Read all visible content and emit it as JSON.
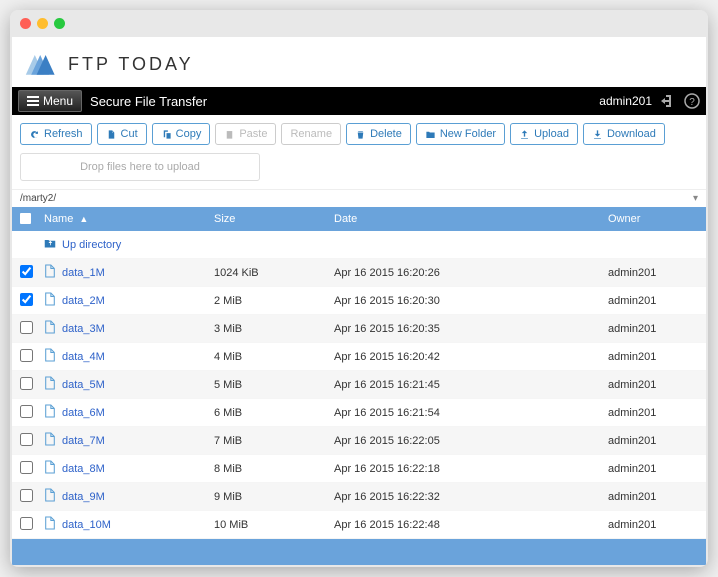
{
  "brand": "FTP TODAY",
  "menubar": {
    "menu_label": "Menu",
    "app_title": "Secure File Transfer",
    "username": "admin201"
  },
  "toolbar": {
    "refresh": "Refresh",
    "cut": "Cut",
    "copy": "Copy",
    "paste": "Paste",
    "rename": "Rename",
    "delete": "Delete",
    "new_folder": "New Folder",
    "upload": "Upload",
    "download": "Download"
  },
  "dropzone": "Drop files here to upload",
  "path": "/marty2/",
  "columns": {
    "name": "Name",
    "size": "Size",
    "date": "Date",
    "owner": "Owner"
  },
  "up_directory": "Up directory",
  "files": [
    {
      "checked": true,
      "name": "data_1M",
      "size": "1024 KiB",
      "date": "Apr 16 2015 16:20:26",
      "owner": "admin201"
    },
    {
      "checked": true,
      "name": "data_2M",
      "size": "2 MiB",
      "date": "Apr 16 2015 16:20:30",
      "owner": "admin201"
    },
    {
      "checked": false,
      "name": "data_3M",
      "size": "3 MiB",
      "date": "Apr 16 2015 16:20:35",
      "owner": "admin201"
    },
    {
      "checked": false,
      "name": "data_4M",
      "size": "4 MiB",
      "date": "Apr 16 2015 16:20:42",
      "owner": "admin201"
    },
    {
      "checked": false,
      "name": "data_5M",
      "size": "5 MiB",
      "date": "Apr 16 2015 16:21:45",
      "owner": "admin201"
    },
    {
      "checked": false,
      "name": "data_6M",
      "size": "6 MiB",
      "date": "Apr 16 2015 16:21:54",
      "owner": "admin201"
    },
    {
      "checked": false,
      "name": "data_7M",
      "size": "7 MiB",
      "date": "Apr 16 2015 16:22:05",
      "owner": "admin201"
    },
    {
      "checked": false,
      "name": "data_8M",
      "size": "8 MiB",
      "date": "Apr 16 2015 16:22:18",
      "owner": "admin201"
    },
    {
      "checked": false,
      "name": "data_9M",
      "size": "9 MiB",
      "date": "Apr 16 2015 16:22:32",
      "owner": "admin201"
    },
    {
      "checked": false,
      "name": "data_10M",
      "size": "10 MiB",
      "date": "Apr 16 2015 16:22:48",
      "owner": "admin201"
    }
  ]
}
